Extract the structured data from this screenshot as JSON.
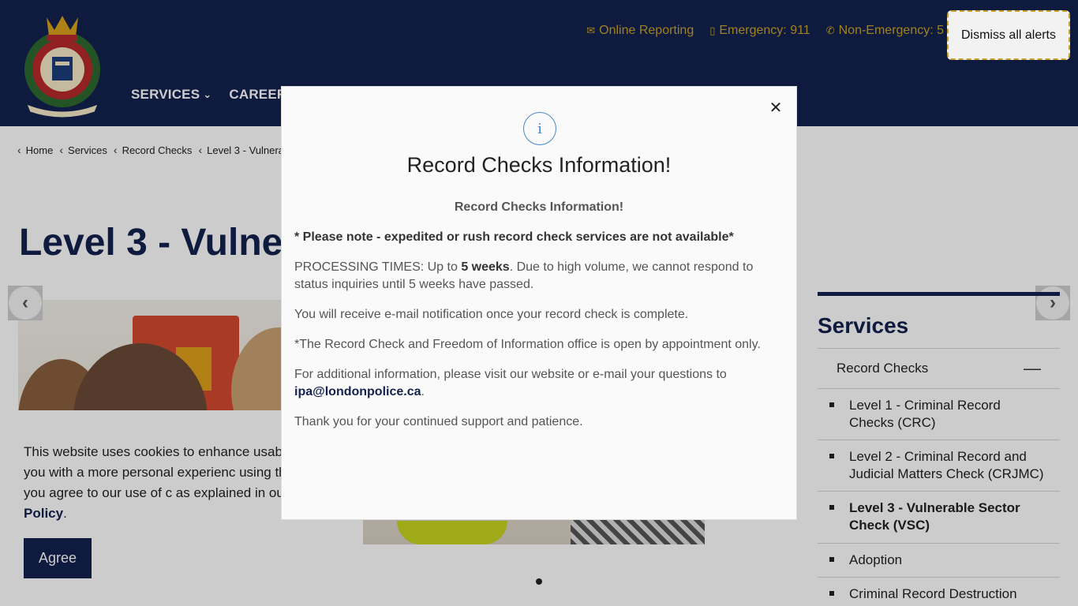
{
  "header": {
    "top_links": [
      {
        "icon": "envelope-icon",
        "label": "Online Reporting"
      },
      {
        "icon": "mobile-phone-icon",
        "label": "Emergency: 911"
      },
      {
        "icon": "phone-icon",
        "label": "Non-Emergency: 5"
      }
    ],
    "nav": [
      {
        "label": "SERVICES",
        "has_dropdown": true
      },
      {
        "label": "CAREER",
        "has_dropdown": false
      }
    ],
    "dismiss_label": "Dismiss all alerts",
    "colors": {
      "navy": "#13214f",
      "gold": "#c9a227"
    }
  },
  "breadcrumb": [
    "Home",
    "Services",
    "Record Checks",
    "Level 3 - Vulnera"
  ],
  "page_title": "Level 3 - Vulne",
  "sidebar": {
    "title": "Services",
    "parent": "Record Checks",
    "items": [
      {
        "label": "Level 1 - Criminal Record Checks (CRC)",
        "active": false
      },
      {
        "label": "Level 2 - Criminal Record and Judicial Matters Check (CRJMC)",
        "active": false
      },
      {
        "label": "Level 3 - Vulnerable Sector Check (VSC)",
        "active": true
      },
      {
        "label": "Adoption",
        "active": false
      },
      {
        "label": "Criminal Record Destruction",
        "active": false
      }
    ]
  },
  "cookie": {
    "text": "This website uses cookies to enhance usab provide you with a more personal experienc using this website, you agree to our use of c as explained in our",
    "policy_link": "Privacy Policy",
    "agree_label": "Agree"
  },
  "modal": {
    "title": "Record Checks Information!",
    "subtitle": "Record Checks Information!",
    "note": "* Please note - expedited or rush record check services are not available*",
    "processing_prefix": "PROCESSING TIMES: Up to ",
    "processing_bold": "5 weeks",
    "processing_suffix": ". Due to high volume, we cannot respond to status inquiries until 5 weeks have passed.",
    "email_notice": "You will receive e-mail notification once your record check is complete.",
    "office_notice": "*The Record Check and Freedom of Information office is open by appointment only.",
    "additional_prefix": "For additional information, please visit our website or e-mail your questions to",
    "email": "ipa@londonpolice.ca",
    "thanks": "Thank you for your continued support and patience."
  },
  "carousel": {
    "active_slide": 1
  }
}
